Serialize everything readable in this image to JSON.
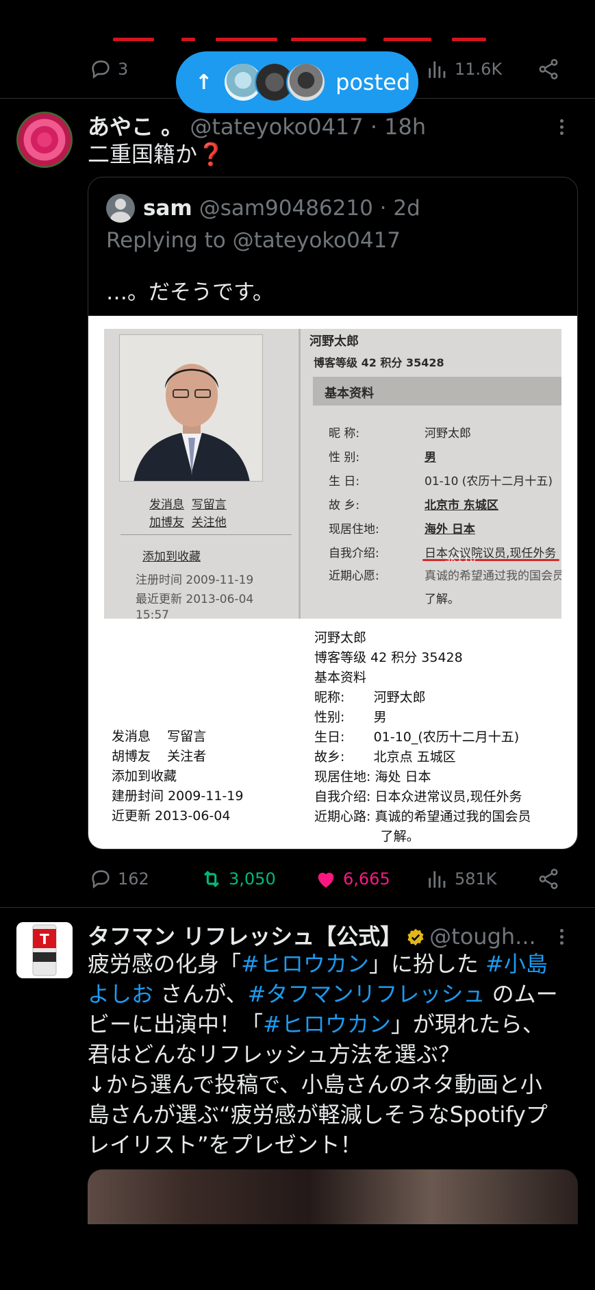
{
  "top_tweet": {
    "replies": "3",
    "views": "11.6K"
  },
  "posted_pill": {
    "arrow": "↑",
    "label": "posted"
  },
  "tweet1": {
    "name": "あやこ 。",
    "handle": "@tateyoko0417 · 18h",
    "text": "二重国籍か❓",
    "quote": {
      "name": "sam",
      "handle": "@sam90486210 · 2d",
      "replying": "Replying to @tateyoko0417",
      "text": "…。だそうです。",
      "scan": {
        "name": "河野太郎",
        "level": "博客等级 42  积分 35428",
        "section": "基本资料",
        "rows": [
          {
            "k": "昵    称:",
            "v": "河野太郎"
          },
          {
            "k": "性    别:",
            "v": "男"
          },
          {
            "k": "生    日:",
            "v": "01-10 (农历十二月十五)"
          },
          {
            "k": "故    乡:",
            "v": "北京市  东城区"
          },
          {
            "k": "现居住地:",
            "v": "海外  日本"
          },
          {
            "k": "自我介绍:",
            "v": "日本众议院议员,现任外务"
          },
          {
            "k": "近期心愿:",
            "v": "真诚的希望通过我的国会员"
          },
          {
            "k": "",
            "v": "了解。"
          }
        ],
        "links": [
          "发消息",
          "写留言",
          "加博友",
          "关注他",
          "添加到收藏"
        ],
        "dates": [
          "注册时间 2009-11-19",
          "最近更新 2013-06-04",
          "15:57"
        ],
        "watermark": "sk11b"
      },
      "transcript_left": "发消息    写留言\n胡博友    关注者\n添加到收藏\n建册封间 2009-11-19\n近更新 2013-06-04",
      "transcript_right": "河野太郎\n博客等级 42 积分 35428\n基本资料\n昵称:       河野太郎\n性别:       男\n生日:       01-10_(农历十二月十五)\n故乡:       北京点 五城区\n现居住地: 海处 日本\n自我介绍: 日本众进常议员,现任外务\n近期心路: 真诚的希望通过我的国会员\n                了解。"
    },
    "replies": "162",
    "retweets": "3,050",
    "likes": "6,665",
    "views": "581K"
  },
  "tweet2": {
    "name": "タフマン リフレッシュ【公式】",
    "handle": "@tough...",
    "text_lines": [
      [
        "疲労感の化身「",
        "#ヒロウカン",
        "」に扮した ",
        "#小島"
      ],
      [
        "よしお",
        " さんが、",
        "#タフマンリフレッシュ",
        " のムー"
      ],
      [
        "ビーに出演中！「",
        "#ヒロウカン",
        "」が現れたら、"
      ],
      [
        "君はどんなリフレッシュ方法を選ぶ？"
      ],
      [
        "↓から選んで投稿で、小島さんのネタ動画と小"
      ],
      [
        "島さんが選ぶ“疲労感が軽減しそうなSpotifyプ"
      ],
      [
        "レイリスト”をプレゼント！"
      ]
    ]
  },
  "colors": {
    "accent": "#1d9bf0",
    "retweet": "#00ba7c",
    "like": "#f91880",
    "muted": "#71767b"
  }
}
